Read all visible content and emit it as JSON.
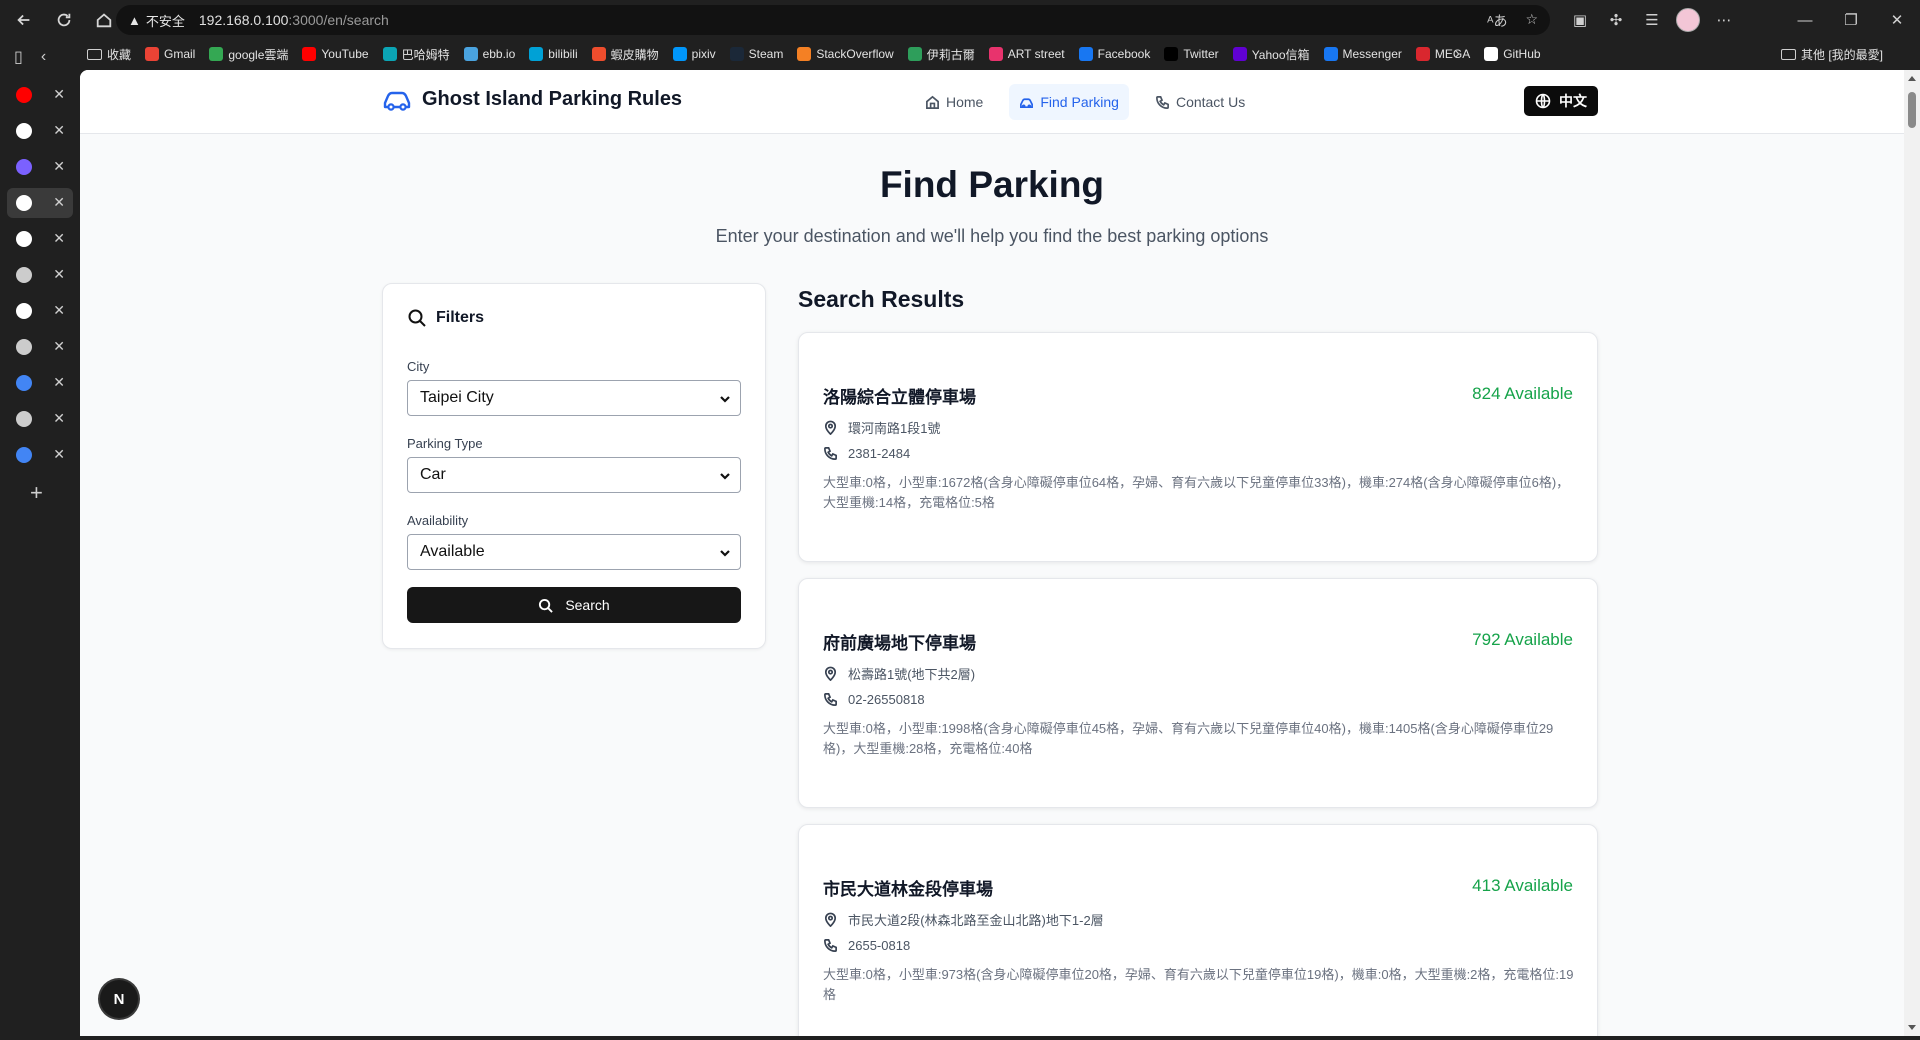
{
  "browser": {
    "security_label": "不安全",
    "url_host": "192.168.0.100",
    "url_path": ":3000/en/search",
    "bookmarks": [
      {
        "label": "收藏",
        "icon": "folder-icon",
        "color": ""
      },
      {
        "label": "Gmail",
        "icon": "gmail-icon",
        "color": "#ea4335"
      },
      {
        "label": "google雲端",
        "icon": "drive-icon",
        "color": "#34a853"
      },
      {
        "label": "YouTube",
        "icon": "youtube-icon",
        "color": "#ff0000"
      },
      {
        "label": "巴哈姆特",
        "icon": "bahamut-icon",
        "color": "#0ba5b5"
      },
      {
        "label": "ebb.io",
        "icon": "ebb-icon",
        "color": "#4aa3df"
      },
      {
        "label": "bilibili",
        "icon": "bilibili-icon",
        "color": "#00a1d6"
      },
      {
        "label": "蝦皮購物",
        "icon": "shopee-icon",
        "color": "#ee4d2d"
      },
      {
        "label": "pixiv",
        "icon": "pixiv-icon",
        "color": "#0096fa"
      },
      {
        "label": "Steam",
        "icon": "steam-icon",
        "color": "#1b2838"
      },
      {
        "label": "StackOverflow",
        "icon": "stackoverflow-icon",
        "color": "#f48024"
      },
      {
        "label": "伊莉古爾",
        "icon": "eyny-icon",
        "color": "#2e9e5b"
      },
      {
        "label": "ART street",
        "icon": "artstreet-icon",
        "color": "#e8336d"
      },
      {
        "label": "Facebook",
        "icon": "facebook-icon",
        "color": "#1877f2"
      },
      {
        "label": "Twitter",
        "icon": "x-icon",
        "color": "#000000"
      },
      {
        "label": "Yahoo信箱",
        "icon": "yahoo-icon",
        "color": "#6001d2"
      },
      {
        "label": "Messenger",
        "icon": "messenger-icon",
        "color": "#1877f2"
      },
      {
        "label": "MEGA",
        "icon": "mega-icon",
        "color": "#d9272e"
      },
      {
        "label": "GitHub",
        "icon": "github-icon",
        "color": "#ffffff"
      }
    ],
    "other_bookmarks": "其他 [我的最愛]",
    "tabs": [
      {
        "icon": "youtube-icon",
        "color": "#ff0000",
        "active": false
      },
      {
        "icon": "github-icon",
        "color": "#ffffff",
        "active": false
      },
      {
        "icon": "copilot-icon",
        "color": "#7b61ff",
        "active": false
      },
      {
        "icon": "triangle-app-icon",
        "color": "#ffffff",
        "active": true
      },
      {
        "icon": "triangle-app-icon",
        "color": "#ffffff",
        "active": false
      },
      {
        "icon": "document-icon",
        "color": "#cccccc",
        "active": false
      },
      {
        "icon": "github-icon",
        "color": "#ffffff",
        "active": false
      },
      {
        "icon": "calendar-icon",
        "color": "#cccccc",
        "active": false
      },
      {
        "icon": "google-icon",
        "color": "#4285f4",
        "active": false
      },
      {
        "icon": "calendar-icon",
        "color": "#cccccc",
        "active": false
      },
      {
        "icon": "google-icon",
        "color": "#4285f4",
        "active": false
      }
    ]
  },
  "header": {
    "brand": "Ghost Island Parking Rules",
    "nav": [
      {
        "label": "Home",
        "icon": "home-icon",
        "active": false
      },
      {
        "label": "Find Parking",
        "icon": "car-icon",
        "active": true
      },
      {
        "label": "Contact Us",
        "icon": "phone-icon",
        "active": false
      }
    ],
    "language_button": "中文",
    "accent_color": "#2563eb"
  },
  "page": {
    "title": "Find Parking",
    "subtitle": "Enter your destination and we'll help you find the best parking options"
  },
  "filters": {
    "title": "Filters",
    "city_label": "City",
    "city_value": "Taipei City",
    "type_label": "Parking Type",
    "type_value": "Car",
    "availability_label": "Availability",
    "availability_value": "Available",
    "search_button": "Search"
  },
  "results": {
    "title": "Search Results",
    "available_color": "#16a34a",
    "items": [
      {
        "name": "洛陽綜合立體停車場",
        "available": "824 Available",
        "address": "環河南路1段1號",
        "phone": "2381-2484",
        "description": "大型車:0格，小型車:1672格(含身心障礙停車位64格，孕婦、育有六歲以下兒童停車位33格)，機車:274格(含身心障礙停車位6格)，大型重機:14格，充電格位:5格"
      },
      {
        "name": "府前廣場地下停車場",
        "available": "792 Available",
        "address": "松壽路1號(地下共2層)",
        "phone": "02-26550818",
        "description": "大型車:0格，小型車:1998格(含身心障礙停車位45格，孕婦、育有六歲以下兒童停車位40格)，機車:1405格(含身心障礙停車位29格)，大型重機:28格，充電格位:40格"
      },
      {
        "name": "市民大道林金段停車場",
        "available": "413 Available",
        "address": "市民大道2段(林森北路至金山北路)地下1-2層",
        "phone": "2655-0818",
        "description": "大型車:0格，小型車:973格(含身心障礙停車位20格，孕婦、育有六歲以下兒童停車位19格)，機車:0格，大型重機:2格，充電格位:19格"
      }
    ]
  },
  "dev_badge": "N"
}
